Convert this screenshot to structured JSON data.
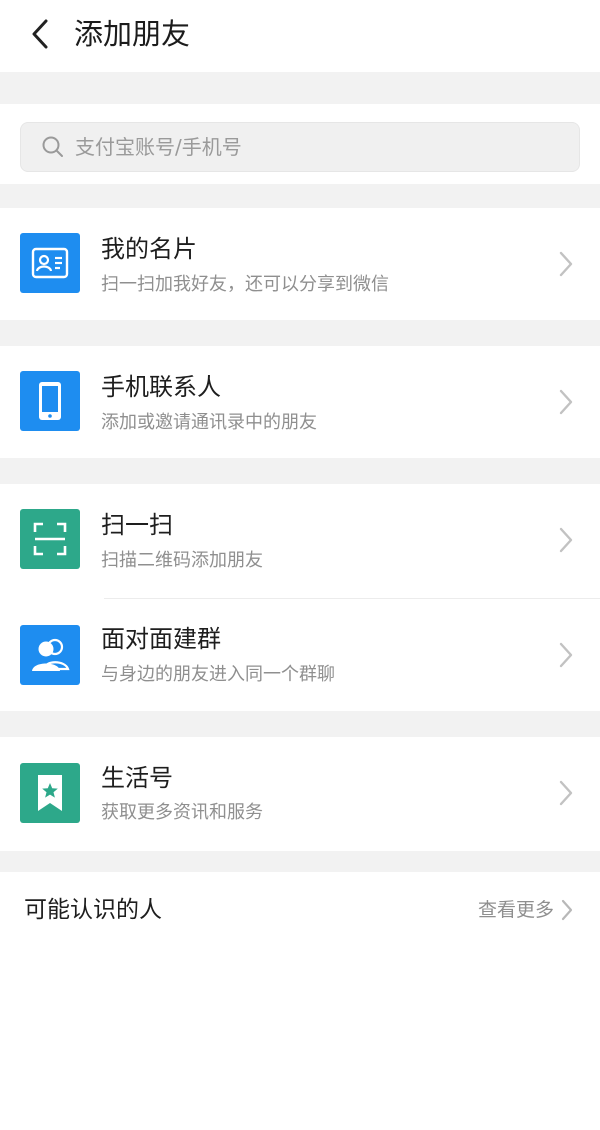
{
  "header": {
    "title": "添加朋友"
  },
  "search": {
    "placeholder": "支付宝账号/手机号"
  },
  "items": [
    {
      "title": "我的名片",
      "subtitle": "扫一扫加我好友，还可以分享到微信",
      "icon": "id-card-icon",
      "color": "#1E8DF0"
    },
    {
      "title": "手机联系人",
      "subtitle": "添加或邀请通讯录中的朋友",
      "icon": "phone-icon",
      "color": "#1E8DF0"
    },
    {
      "title": "扫一扫",
      "subtitle": "扫描二维码添加朋友",
      "icon": "scan-icon",
      "color": "#2DA88A"
    },
    {
      "title": "面对面建群",
      "subtitle": "与身边的朋友进入同一个群聊",
      "icon": "people-icon",
      "color": "#1E8DF0"
    },
    {
      "title": "生活号",
      "subtitle": "获取更多资讯和服务",
      "icon": "bookmark-star-icon",
      "color": "#2DA88A"
    }
  ],
  "people": {
    "title": "可能认识的人",
    "see_more": "查看更多"
  }
}
